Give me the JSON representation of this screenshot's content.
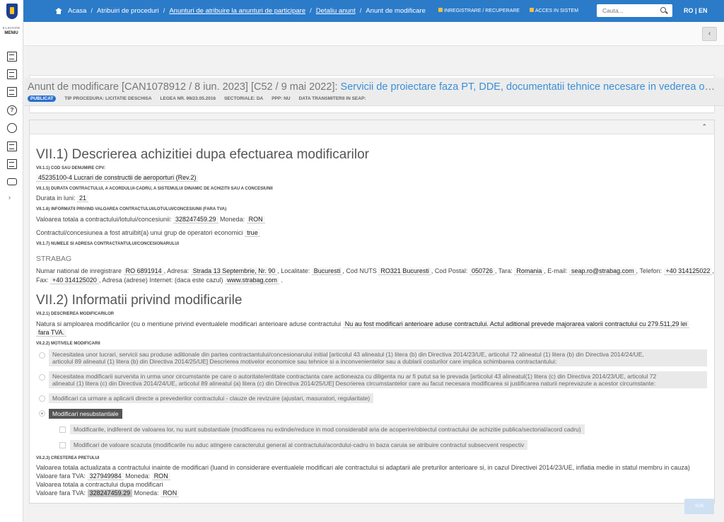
{
  "sidebar": {
    "brand": "E-LICITATIE",
    "menu": "MENIU"
  },
  "breadcrumb": [
    "Acasa",
    "Atribuiri de proceduri",
    "Anunturi de atribuire la anunturi de participare",
    "Detaliu anunt",
    "Anunt de modificare"
  ],
  "top_links": {
    "register": "INREGISTRARE / RECUPERARE",
    "login": "ACCES IN SISTEM"
  },
  "search": {
    "placeholder": "Cauta..."
  },
  "lang": "RO | EN",
  "back": "‹",
  "title": {
    "prefix": "Anunt de modificare [CAN1078912 / 8 iun. 2023] [C52 / 9 mai 2022]:",
    "name": "Servicii de proiectare faza PT, DDE, documentatii tehnice necesare in vederea obtinerii avizelor/ac..."
  },
  "meta": {
    "status": "PUBLICAT",
    "procedure": "TIP PROCEDURA: LICITATIE DESCHISA",
    "law": "LEGEA NR. 99/23.05.2016",
    "sectoral": "SECTORIALE: DA",
    "ppp": "PPP: NU",
    "seap": "DATA TRANSMITERII IN SEAP:"
  },
  "s71": {
    "heading": "VII.1) Descrierea achizitiei dupa efectuarea modificarilor",
    "cpv_label": "VII.1.1) COD SAU DENUMIRE CPV:",
    "cpv": "45235100-4 Lucrari de constructii de aeroporturi (Rev.2)",
    "duration_label": "VII.1.5) DURATA CONTRACTULUI, A ACORDULUI-CADRU, A SISTEMULUI DINAMIC DE ACHIZITII SAU A CONCESIUNII",
    "duration_text": "Durata in luni:",
    "duration": "21",
    "value_label": "VII.1.6) INFORMATII PRIVIND VALOAREA CONTRACTULUI/LOTULUI/CONCESIUNII (FARA TVA)",
    "value_text": "Valoarea totala a contractului/lotului/concesiunii:",
    "value": "328247459.29",
    "currency_text": "Moneda:",
    "currency": "RON",
    "group_text": "Contractul/concesiunea a fost atruibit(a) unui grup de operatori economici",
    "group": "true",
    "contractor_label": "VII.1.7) NUMELE SI ADRESA CONTRACTANTULUI/CONCESIONARULUI",
    "contractor": "STRABAG",
    "reg_text": "Numar national de inregistrare",
    "reg": "RO 6891914",
    "addr_text": ", Adresa:",
    "addr": "Strada 13 Septembrie, Nr. 90",
    "city_text": ", Localitate:",
    "city": "Bucuresti",
    "nuts_text": ", Cod NUTS",
    "nuts": "RO321 Bucuresti",
    "postal_text": ", Cod Postal:",
    "postal": "050726",
    "country_text": ", Tara:",
    "country": "Romania",
    "email_text": ", E-mail:",
    "email": "seap.ro@strabag.com",
    "phone_text": ", Telefon:",
    "phone": "+40 314125022",
    "fax_text": "Fax:",
    "fax": "+40 314125020",
    "web_text": ", Adresa (adrese) Internet: (daca este cazul)",
    "web": "www.strabag.com"
  },
  "s72": {
    "heading": "VII.2) Informatii privind modificarile",
    "desc_label": "VII.2.1) DESCRIEREA MODIFICARILOR",
    "desc_text": "Natura si amploarea modificarilor (cu o mentiune privind eventualele modificari anterioare aduse contractului",
    "desc_value_1": "Nu au fost modificari anterioare aduse contractului. Actul aditional prevede majorarea valorii contractului cu 279.511,29 lei",
    "desc_value_2": "fara TVA.",
    "reasons_label": "VII.2.2) MOTIVELE MODIFICARII",
    "opt1_l1": "Necesitatea unor lucrari, servicii sau produse aditionale din partea contractantului/concesionarului initial [articolul 43 alineatul (1) litera (b) din Directiva 2014/23/UE, articolul 72 alineatul (1) litera (b) din Directiva 2014/24/UE,",
    "opt1_l2": "articolul 89 alineatul (1) litera (b) din Directiva 2014/25/UE] Descrierea motivelor economice sau tehnice si a inconvenientelor sau a dublarii costurilor care implica schimbarea contractantului:",
    "opt2_l1": "Necesitatea modificarii survenita in urma unor circumstante pe care o autoritate/entitate contractanta care actioneaza cu diligenta nu ar fi putut sa le prevada [articolul 43 alineatul(1) litera (c) din Directiva 2014/23/UE, articolul 72",
    "opt2_l2": "alineatul (1) litera (c) din Directiva 2014/24/UE, articolul 89 alineatul (a) litera (c) din Directiva 2014/25/UE] Descrierea circumstantelor care au facut necesara modificarea si justificarea naturii neprevazute a acestor circumstante:",
    "opt3": "Modificari ca urmare a aplicarii directe a prevederilor contractului - clauze de revizuire (ajustari, masuratori, regularitate)",
    "opt4": "Modificari nesubstantiale",
    "sub1": "Modificarile, indiferent de valoarea lor, nu sunt substantiale (modificarea nu extinde/reduce in mod considerabil aria de acoperire/obiectul contractului de achizitie publica/sectorial/acord cadru)",
    "sub2": "Modificari de valoare scazuta (modificarile nu aduc atingere caracterului general al contractului/acordului-cadru in baza caruia se atribuire contractul subsecvent respectiv",
    "price_label": "VII.2.3) CRESTEREA PRETULUI",
    "price_text": "Valoarea totala actualizata a contractului inainte de modificari (luand in considerare eventualele modificari ale contractului si adaptarii ale preturilor anterioare si, in cazul Directivei 2014/23/UE, inflatia medie in statul membru in cauza)",
    "vat_text": "Valoare fara TVA:",
    "before": "327949984",
    "currency_text": "Moneda:",
    "currency": "RON",
    "after_text": "Valoarea totala a contractului dupa modificari",
    "after": "328247459.29"
  },
  "top_btn": "SUS"
}
